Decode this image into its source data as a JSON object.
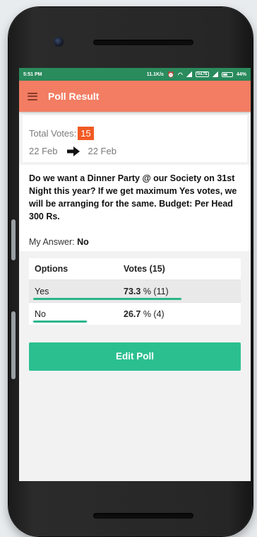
{
  "status_bar": {
    "time": "5:51 PM",
    "net_speed": "11.1K/s",
    "volte": "VoLTE",
    "battery": "44%"
  },
  "app_bar": {
    "title": "Poll Result"
  },
  "summary": {
    "total_votes_label": "Total Votes:",
    "total_votes_value": "15",
    "start_date": "22 Feb",
    "end_date": "22 Feb"
  },
  "question": {
    "text": "Do we want a Dinner Party @ our Society on 31st Night this year? If we get maximum Yes votes, we will be arranging for the same. Budget: Per Head 300 Rs.",
    "answer_label": "My Answer:",
    "answer_value": "No"
  },
  "results": {
    "col_options": "Options",
    "col_votes": "Votes (15)",
    "rows": [
      {
        "option": "Yes",
        "percent": "73.3",
        "unit": " % ",
        "count": "(11)",
        "fraction": 0.733
      },
      {
        "option": "No",
        "percent": "26.7",
        "unit": " % ",
        "count": "(4)",
        "fraction": 0.267
      }
    ]
  },
  "actions": {
    "edit_label": "Edit Poll"
  },
  "colors": {
    "status_bar": "#2a8b5d",
    "app_bar": "#f27d63",
    "accent": "#2bbf8f",
    "votes_badge": "#f15a24"
  }
}
